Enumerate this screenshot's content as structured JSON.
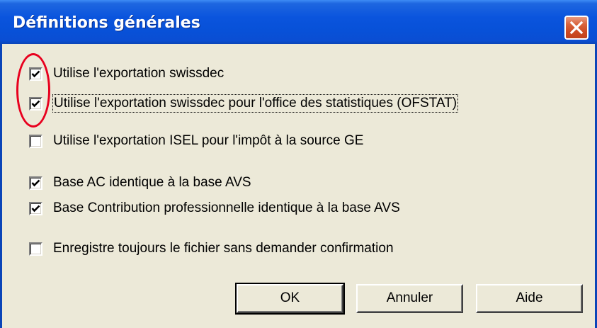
{
  "window": {
    "title": "Définitions générales"
  },
  "options": [
    {
      "label": "Utilise l'exportation swissdec",
      "checked": true
    },
    {
      "label": "Utilise l'exportation swissdec pour l'office des statistiques (OFSTAT)",
      "checked": true
    },
    {
      "label": "Utilise l'exportation ISEL pour l'impôt à la source GE",
      "checked": false
    },
    {
      "label": "Base AC identique à la base AVS",
      "checked": true
    },
    {
      "label": "Base Contribution professionnelle identique à la base AVS",
      "checked": true
    },
    {
      "label": "Enregistre toujours le fichier sans demander confirmation",
      "checked": false
    }
  ],
  "buttons": {
    "ok": "OK",
    "cancel": "Annuler",
    "help": "Aide"
  },
  "colors": {
    "titlebar": "#0a54dd",
    "dialog_background": "#ece9d8",
    "annotation": "#e8001e"
  },
  "icons": {
    "close": "close-icon",
    "check": "checkmark-icon"
  }
}
